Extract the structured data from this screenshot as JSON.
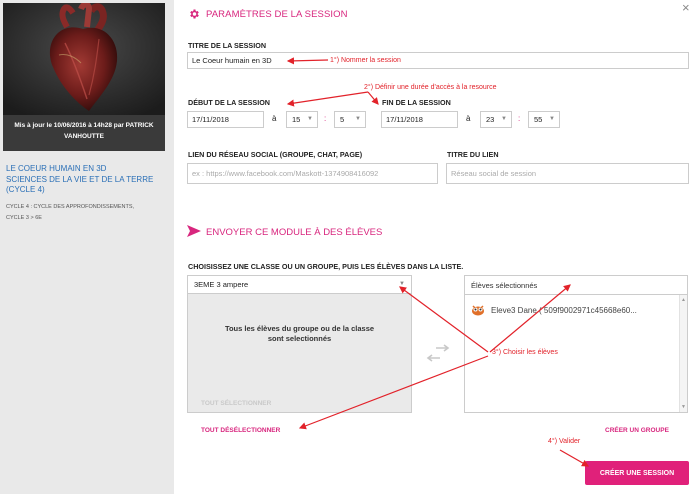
{
  "module": {
    "update_text": "Mis à jour le 10/06/2016 à 14h28 par PATRICK VANHOUTTE",
    "title_lines": [
      "LE COEUR HUMAIN EN 3D",
      "SCIENCES DE LA VIE ET DE LA TERRE",
      "(CYCLE 4)"
    ],
    "meta_lines": [
      "CYCLE 4 : CYCLE DES APPROFONDISSEMENTS,",
      "CYCLE 3 > 6E"
    ]
  },
  "header": {
    "close_label": "×",
    "title": "PARAMÈTRES DE LA SESSION",
    "icon": "gear-icon"
  },
  "session": {
    "title_label": "TITRE DE LA SESSION",
    "title_value": "Le Coeur humain en 3D",
    "start_label": "DÉBUT DE LA SESSION",
    "start_date": "17/11/2018",
    "start_hour": "15",
    "start_minute": "5",
    "end_label": "FIN DE LA SESSION",
    "end_date": "17/11/2018",
    "end_hour": "23",
    "end_minute": "55",
    "at_label": "à",
    "colon": ":",
    "social_label": "LIEN DU RÉSEAU SOCIAL (GROUPE, CHAT, PAGE)",
    "social_placeholder": "ex : https://www.facebook.com/Maskott-1374908416092",
    "link_title_label": "TITRE DU LIEN",
    "link_title_placeholder": "Réseau social de session"
  },
  "send": {
    "title": "ENVOYER CE MODULE À DES ÉLÈVES",
    "choose_label": "CHOISISSEZ UNE CLASSE OU UN GROUPE, PUIS LES ÉLÈVES DANS LA LISTE.",
    "group_value": "3EME 3  ampere",
    "group_message": "Tous les élèves du groupe ou de la classe sont selectionnés",
    "selected_title": "Élèves sélectionnés",
    "students": [
      "Eleve3 Dane ( 509f9002971c45668e60..."
    ],
    "select_all": "TOUT SÉLECTIONNER",
    "deselect_all": "TOUT DÉSÉLECTIONNER",
    "create_group": "CRÉER UN GROUPE",
    "create_session": "CRÉER UNE SESSION"
  },
  "annotations": {
    "step1": "1°) Nommer la session",
    "step2": "2°) Définir une durée d'accès à la resource",
    "step3": "3°) Choisir les élèves",
    "step4": "4°) Valider"
  },
  "colors": {
    "accent": "#d8267e",
    "annotation": "#e2222a",
    "link": "#2a6fb6"
  }
}
